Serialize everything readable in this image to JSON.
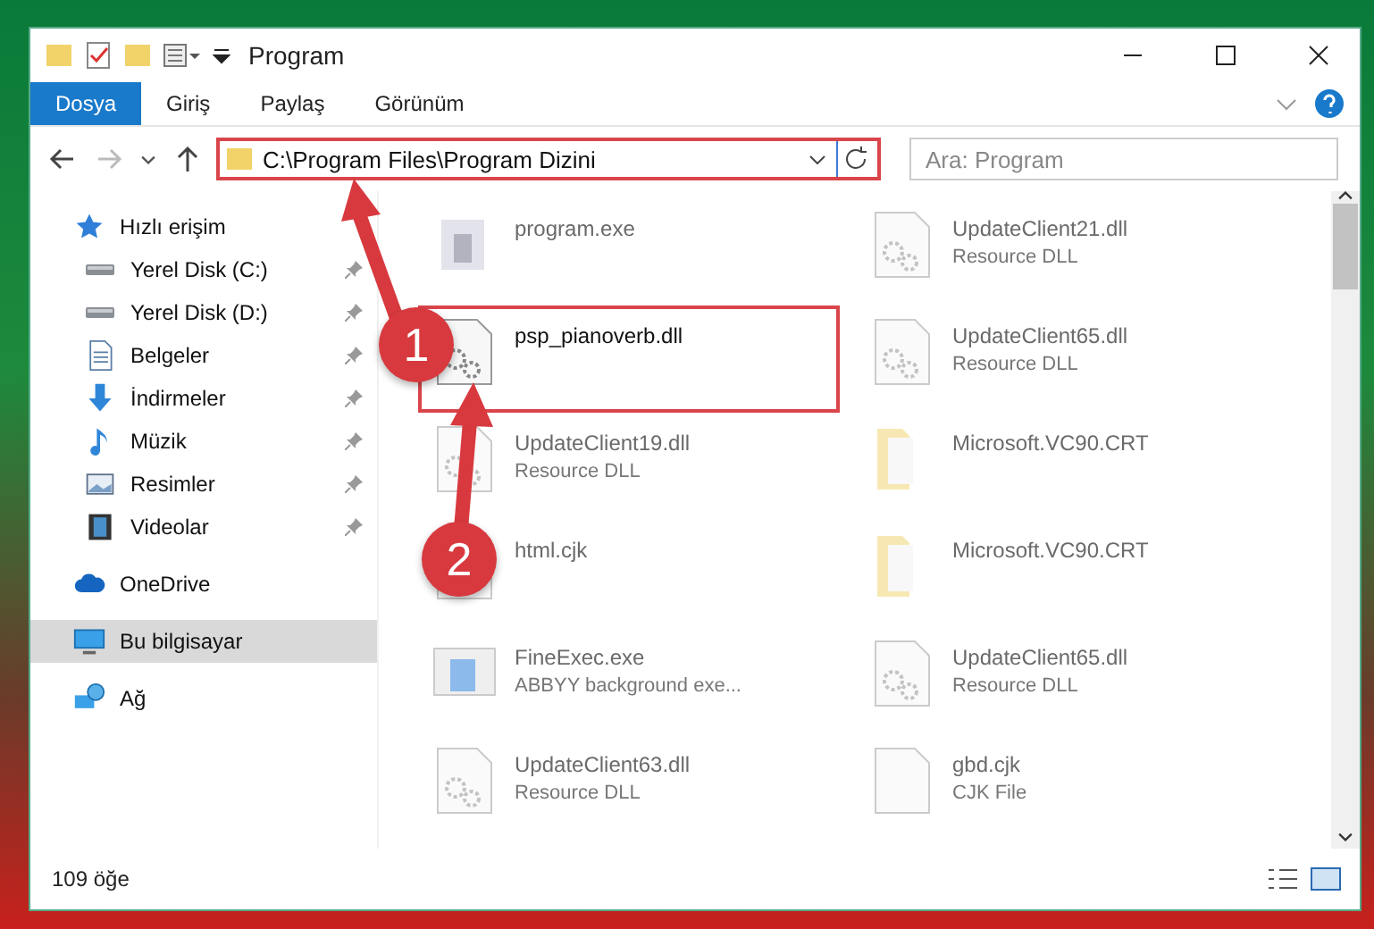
{
  "window": {
    "title": "Program"
  },
  "ribbon_tabs": [
    {
      "label": "Dosya",
      "selected": true
    },
    {
      "label": "Giriş",
      "selected": false
    },
    {
      "label": "Paylaş",
      "selected": false
    },
    {
      "label": "Görünüm",
      "selected": false
    }
  ],
  "address": {
    "path": "C:\\Program Files\\Program Dizini",
    "highlighted": true
  },
  "search": {
    "placeholder": "Ara: Program"
  },
  "sidebar": {
    "items": [
      {
        "label": "Hızlı erişim",
        "kind": "star",
        "pinned": false,
        "selected": false,
        "children": [
          {
            "label": "Yerel Disk (C:)",
            "kind": "drive",
            "pinned": true,
            "selected": false
          },
          {
            "label": "Yerel Disk (D:)",
            "kind": "drive",
            "pinned": true,
            "selected": false
          },
          {
            "label": "Belgeler",
            "kind": "document",
            "pinned": true,
            "selected": false
          },
          {
            "label": "İndirmeler",
            "kind": "download",
            "pinned": true,
            "selected": false
          },
          {
            "label": "Müzik",
            "kind": "music",
            "pinned": true,
            "selected": false
          },
          {
            "label": "Resimler",
            "kind": "picture",
            "pinned": true,
            "selected": false
          },
          {
            "label": "Videolar",
            "kind": "video",
            "pinned": true,
            "selected": false
          }
        ]
      },
      {
        "label": "OneDrive",
        "kind": "cloud",
        "pinned": false,
        "selected": false
      },
      {
        "label": "Bu bilgisayar",
        "kind": "computer",
        "pinned": false,
        "selected": true
      },
      {
        "label": "Ağ",
        "kind": "network",
        "pinned": false,
        "selected": false
      }
    ]
  },
  "files": [
    {
      "name": "program.exe",
      "kind": "exe",
      "highlighted": false
    },
    {
      "name": "UpdateClient21.dll",
      "type": "Resource DLL",
      "kind": "dll",
      "highlighted": false
    },
    {
      "name": "psp_pianoverb.dll",
      "kind": "dll",
      "highlighted": true
    },
    {
      "name": "UpdateClient65.dll",
      "type": "Resource DLL",
      "kind": "dll",
      "highlighted": false
    },
    {
      "name": "UpdateClient19.dll",
      "type": "Resource DLL",
      "kind": "dll",
      "highlighted": false
    },
    {
      "name": "Microsoft.VC90.CRT",
      "kind": "folder",
      "highlighted": false
    },
    {
      "name": "html.cjk",
      "kind": "file",
      "highlighted": false
    },
    {
      "name": "Microsoft.VC90.CRT",
      "kind": "folder",
      "highlighted": false
    },
    {
      "name": "FineExec.exe",
      "type": "ABBYY background exe...",
      "kind": "app",
      "highlighted": false
    },
    {
      "name": "UpdateClient65.dll",
      "type": "Resource DLL",
      "kind": "dll",
      "highlighted": false
    },
    {
      "name": "UpdateClient63.dll",
      "type": "Resource DLL",
      "kind": "dll",
      "highlighted": false
    },
    {
      "name": "gbd.cjk",
      "type": "CJK File",
      "kind": "file",
      "highlighted": false
    }
  ],
  "status_bar": {
    "count": "109 öğe"
  },
  "annotations": [
    {
      "number": "1"
    },
    {
      "number": "2"
    }
  ]
}
